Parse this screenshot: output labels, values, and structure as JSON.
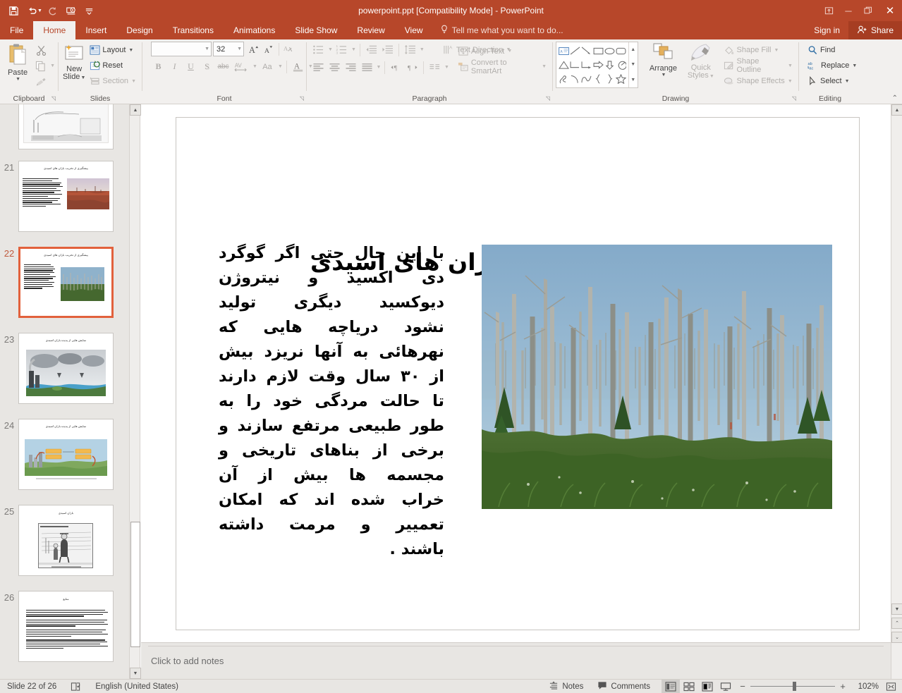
{
  "titlebar": {
    "title": "powerpoint.ppt [Compatibility Mode] - PowerPoint",
    "qat": [
      {
        "name": "save-icon",
        "glyph": "Ὃe"
      },
      {
        "name": "undo-icon",
        "glyph": "↶"
      },
      {
        "name": "redo-icon",
        "glyph": "↻"
      },
      {
        "name": "start-presentation-icon",
        "glyph": "▶"
      },
      {
        "name": "customize-qat-icon",
        "glyph": "≡"
      }
    ],
    "window_controls": [
      {
        "name": "ribbon-display-options",
        "glyph": "⬚"
      },
      {
        "name": "minimize",
        "glyph": "–"
      },
      {
        "name": "restore",
        "glyph": "❐"
      },
      {
        "name": "close",
        "glyph": "✕"
      }
    ]
  },
  "tabs": [
    {
      "label": "File",
      "active": false
    },
    {
      "label": "Home",
      "active": true
    },
    {
      "label": "Insert",
      "active": false
    },
    {
      "label": "Design",
      "active": false
    },
    {
      "label": "Transitions",
      "active": false
    },
    {
      "label": "Animations",
      "active": false
    },
    {
      "label": "Slide Show",
      "active": false
    },
    {
      "label": "Review",
      "active": false
    },
    {
      "label": "View",
      "active": false
    }
  ],
  "tellme": {
    "label": "Tell me what you want to do...",
    "icon": "lightbulb-icon"
  },
  "account": {
    "signin_label": "Sign in",
    "share_label": "Share"
  },
  "ribbon": {
    "groups": [
      {
        "name": "clipboard",
        "label": "Clipboard",
        "paste_label": "Paste",
        "items": [
          "Cut",
          "Copy",
          "Format Painter"
        ]
      },
      {
        "name": "slides",
        "label": "Slides",
        "new_slide_label": "New\nSlide",
        "new_slide_line1": "New",
        "new_slide_line2": "Slide",
        "layout_label": "Layout",
        "reset_label": "Reset",
        "section_label": "Section"
      },
      {
        "name": "font",
        "label": "Font",
        "font_name_value": "",
        "font_name_placeholder": "",
        "font_size_value": "32",
        "buttons": [
          "Bold",
          "Italic",
          "Underline",
          "Text Shadow",
          "Strikethrough",
          "Character Spacing",
          "Change Case",
          "Font Color"
        ]
      },
      {
        "name": "paragraph",
        "label": "Paragraph",
        "text_direction_label": "Text Direction",
        "align_text_label": "Align Text",
        "convert_smartart_label": "Convert to SmartArt"
      },
      {
        "name": "drawing",
        "label": "Drawing",
        "arrange_label": "Arrange",
        "quick_styles_line1": "Quick",
        "quick_styles_line2": "Styles",
        "shape_fill_label": "Shape Fill",
        "shape_outline_label": "Shape Outline",
        "shape_effects_label": "Shape Effects"
      },
      {
        "name": "editing",
        "label": "Editing",
        "find_label": "Find",
        "replace_label": "Replace",
        "select_label": "Select"
      }
    ]
  },
  "thumbnails": [
    {
      "number": "20",
      "title": "",
      "selected": false,
      "kind": "diagram-partial"
    },
    {
      "number": "21",
      "title": "پیشگیری از تخریب باران های اسیدی",
      "selected": false,
      "kind": "text-photo-red"
    },
    {
      "number": "22",
      "title": "پیشگیری از تخریب باران های اسیدی",
      "selected": true,
      "kind": "text-photo-forest"
    },
    {
      "number": "23",
      "title": "نمایش هایی از پدیده باران اسیدی",
      "selected": false,
      "kind": "cloud-diagram"
    },
    {
      "number": "24",
      "title": "نمایش هایی از پدیده باران اسیدی",
      "selected": false,
      "kind": "infographic"
    },
    {
      "number": "25",
      "title": "باران اسیدی",
      "selected": false,
      "kind": "cartoon"
    },
    {
      "number": "26",
      "title": "منابع",
      "selected": false,
      "kind": "bullet-text"
    }
  ],
  "slide": {
    "title": "پیشگیری از تخریب باران های اسیدی",
    "body_lines": [
      "با این حال حتی اگر گوگرد",
      "دی اکسید و نیتروژن",
      "دیوکسید دیگری تولید",
      "نشود دریاچه هایی که",
      "نهرهائی به آنها نریزد بیش",
      "از ۳۰ سال وقت لازم دارند",
      "تا حالت مردگی خود را به",
      "طور طبیعی مرتفع سازند و",
      "برخی از بناهای تاریخی و",
      "مجسمه ها بیش از آن",
      "خراب شده اند که امکان",
      "تعمییر و مرمت داشته",
      "باشند ."
    ],
    "image_alt": "dead-forest-photo"
  },
  "notes": {
    "placeholder": "Click to add notes"
  },
  "statusbar": {
    "slide_indicator": "Slide 22 of 26",
    "language": "English (United States)",
    "notes_label": "Notes",
    "comments_label": "Comments",
    "zoom_level": "102%",
    "views": [
      "Normal",
      "Slide Sorter",
      "Reading View",
      "Slide Show"
    ]
  },
  "colors": {
    "accent": "#b7472a",
    "share_bg": "#a63d22",
    "selected_thumb_border": "#e2613c",
    "ribbon_bg": "#f2f0ee"
  }
}
